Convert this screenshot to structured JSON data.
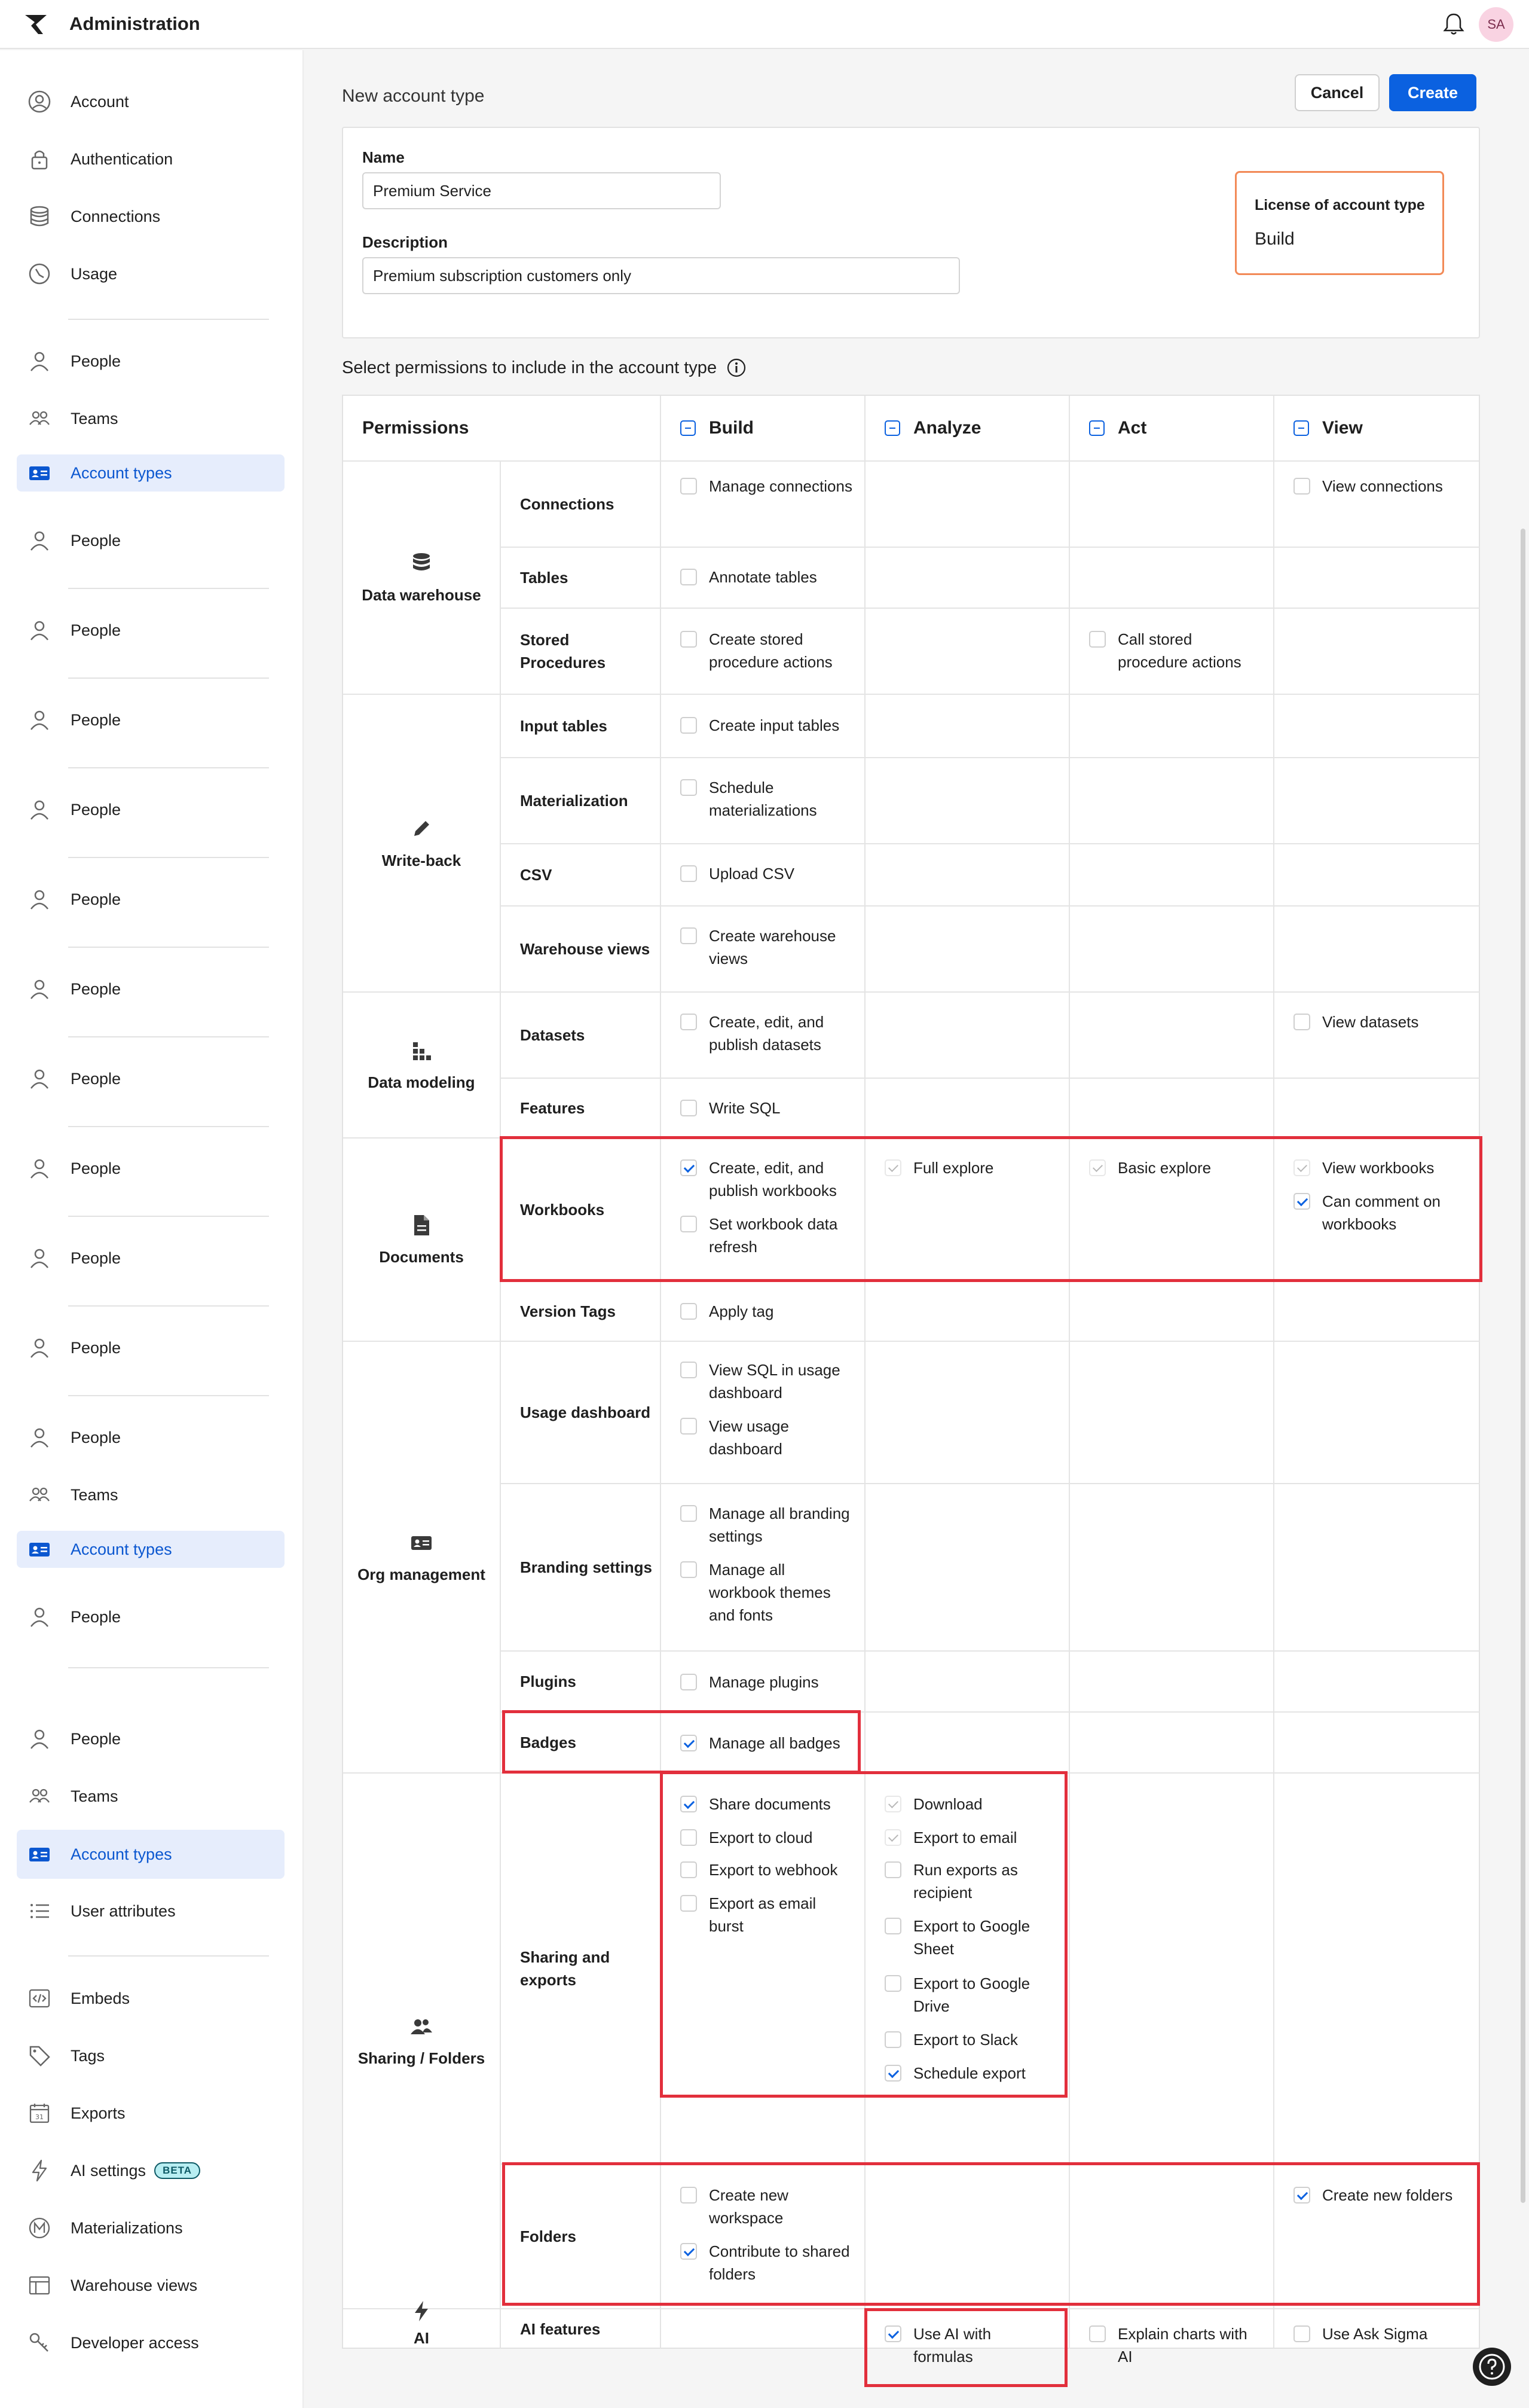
{
  "app": {
    "title": "Administration",
    "avatar_initials": "SA"
  },
  "sidebar": {
    "items": [
      {
        "label": "Account",
        "icon": "account-circle-icon"
      },
      {
        "label": "Authentication",
        "icon": "lock-icon"
      },
      {
        "label": "Connections",
        "icon": "database-icon"
      },
      {
        "label": "Usage",
        "icon": "usage-gauge-icon"
      },
      {
        "label": "People",
        "icon": "person-icon"
      },
      {
        "label": "Teams",
        "icon": "teams-icon"
      },
      {
        "label": "Account types",
        "icon": "id-card-icon"
      },
      {
        "label": "People",
        "icon": "person-icon"
      },
      {
        "label": "People",
        "icon": "person-icon"
      },
      {
        "label": "People",
        "icon": "person-icon"
      },
      {
        "label": "People",
        "icon": "person-icon"
      },
      {
        "label": "People",
        "icon": "person-icon"
      },
      {
        "label": "People",
        "icon": "person-icon"
      },
      {
        "label": "People",
        "icon": "person-icon"
      },
      {
        "label": "People",
        "icon": "person-icon"
      },
      {
        "label": "People",
        "icon": "person-icon"
      },
      {
        "label": "People",
        "icon": "person-icon"
      },
      {
        "label": "People",
        "icon": "person-icon"
      },
      {
        "label": "Teams",
        "icon": "teams-icon"
      },
      {
        "label": "Account types",
        "icon": "id-card-icon"
      },
      {
        "label": "People",
        "icon": "person-icon"
      },
      {
        "label": "People",
        "icon": "person-icon"
      },
      {
        "label": "Teams",
        "icon": "teams-icon"
      },
      {
        "label": "Account types",
        "icon": "id-card-icon"
      },
      {
        "label": "User attributes",
        "icon": "list-icon"
      },
      {
        "label": "Embeds",
        "icon": "embed-code-icon"
      },
      {
        "label": "Tags",
        "icon": "tag-icon"
      },
      {
        "label": "Exports",
        "icon": "calendar-export-icon"
      },
      {
        "label": "AI settings",
        "icon": "lightning-icon",
        "badge": "BETA"
      },
      {
        "label": "Materializations",
        "icon": "materialization-icon"
      },
      {
        "label": "Warehouse views",
        "icon": "table-view-icon"
      },
      {
        "label": "Developer access",
        "icon": "key-icon"
      }
    ]
  },
  "header": {
    "page_title": "New account type",
    "cancel_label": "Cancel",
    "create_label": "Create"
  },
  "form": {
    "name_label": "Name",
    "name_value": "Premium Service",
    "description_label": "Description",
    "description_value": "Premium subscription customers only",
    "license_label": "License of account type",
    "license_value": "Build"
  },
  "permissions": {
    "heading": "Select permissions to include in the account type",
    "columns": [
      "Permissions",
      "Build",
      "Analyze",
      "Act",
      "View"
    ],
    "categories": [
      {
        "name": "Data warehouse",
        "icon": "database-icon"
      },
      {
        "name": "Write-back",
        "icon": "pencil-icon"
      },
      {
        "name": "Data modeling",
        "icon": "data-model-icon"
      },
      {
        "name": "Documents",
        "icon": "document-icon"
      },
      {
        "name": "Org management",
        "icon": "id-card-icon"
      },
      {
        "name": "Sharing / Folders",
        "icon": "people-icon"
      },
      {
        "name": "AI",
        "icon": "lightning-icon"
      }
    ],
    "rows": [
      {
        "label": "Connections"
      },
      {
        "label": "Tables"
      },
      {
        "label": "Stored Procedures"
      },
      {
        "label": "Input tables"
      },
      {
        "label": "Materialization"
      },
      {
        "label": "CSV"
      },
      {
        "label": "Warehouse views"
      },
      {
        "label": "Datasets"
      },
      {
        "label": "Features"
      },
      {
        "label": "Workbooks"
      },
      {
        "label": "Version Tags"
      },
      {
        "label": "Usage dashboard"
      },
      {
        "label": "Branding settings"
      },
      {
        "label": "Plugins"
      },
      {
        "label": "Badges"
      },
      {
        "label": "Sharing and exports"
      },
      {
        "label": "Folders"
      },
      {
        "label": "AI features"
      }
    ],
    "perms": [
      {
        "label": "Manage connections",
        "state": "off"
      },
      {
        "label": "View connections",
        "state": "off"
      },
      {
        "label": "Annotate tables",
        "state": "off"
      },
      {
        "label": "Create stored procedure actions",
        "state": "off"
      },
      {
        "label": "Call stored procedure actions",
        "state": "off"
      },
      {
        "label": "Create input tables",
        "state": "off"
      },
      {
        "label": "Schedule materializations",
        "state": "off"
      },
      {
        "label": "Upload CSV",
        "state": "off"
      },
      {
        "label": "Create warehouse views",
        "state": "off"
      },
      {
        "label": "Create, edit, and publish datasets",
        "state": "off"
      },
      {
        "label": "View datasets",
        "state": "off"
      },
      {
        "label": "Write SQL",
        "state": "off"
      },
      {
        "label": "Create, edit, and publish workbooks",
        "state": "on"
      },
      {
        "label": "Set workbook data refresh",
        "state": "off"
      },
      {
        "label": "Full explore",
        "state": "dim"
      },
      {
        "label": "Basic explore",
        "state": "dim"
      },
      {
        "label": "View workbooks",
        "state": "dim"
      },
      {
        "label": "Can comment on workbooks",
        "state": "on"
      },
      {
        "label": "Apply tag",
        "state": "off"
      },
      {
        "label": "View SQL in usage dashboard",
        "state": "off"
      },
      {
        "label": "View usage dashboard",
        "state": "off"
      },
      {
        "label": "Manage all branding settings",
        "state": "off"
      },
      {
        "label": "Manage all workbook themes and fonts",
        "state": "off"
      },
      {
        "label": "Manage plugins",
        "state": "off"
      },
      {
        "label": "Manage all badges",
        "state": "on"
      },
      {
        "label": "Share documents",
        "state": "on"
      },
      {
        "label": "Export to cloud",
        "state": "off"
      },
      {
        "label": "Export to webhook",
        "state": "off"
      },
      {
        "label": "Export as email burst",
        "state": "off"
      },
      {
        "label": "Download",
        "state": "dim"
      },
      {
        "label": "Export to email",
        "state": "dim"
      },
      {
        "label": "Run exports as recipient",
        "state": "off"
      },
      {
        "label": "Export to Google Sheet",
        "state": "off"
      },
      {
        "label": "Export to Google Drive",
        "state": "off"
      },
      {
        "label": "Export to Slack",
        "state": "off"
      },
      {
        "label": "Schedule export",
        "state": "on"
      },
      {
        "label": "Create new workspace",
        "state": "off"
      },
      {
        "label": "Contribute to shared folders",
        "state": "on"
      },
      {
        "label": "Create new folders",
        "state": "on"
      },
      {
        "label": "Use AI with formulas",
        "state": "on"
      },
      {
        "label": "Explain charts with AI",
        "state": "off"
      },
      {
        "label": "Use Ask Sigma",
        "state": "off"
      }
    ]
  },
  "colors": {
    "accent": "#0b61e0",
    "highlight": "#e22f3c",
    "license_border": "#f28a57",
    "active_nav_bg": "#e6edfc"
  }
}
